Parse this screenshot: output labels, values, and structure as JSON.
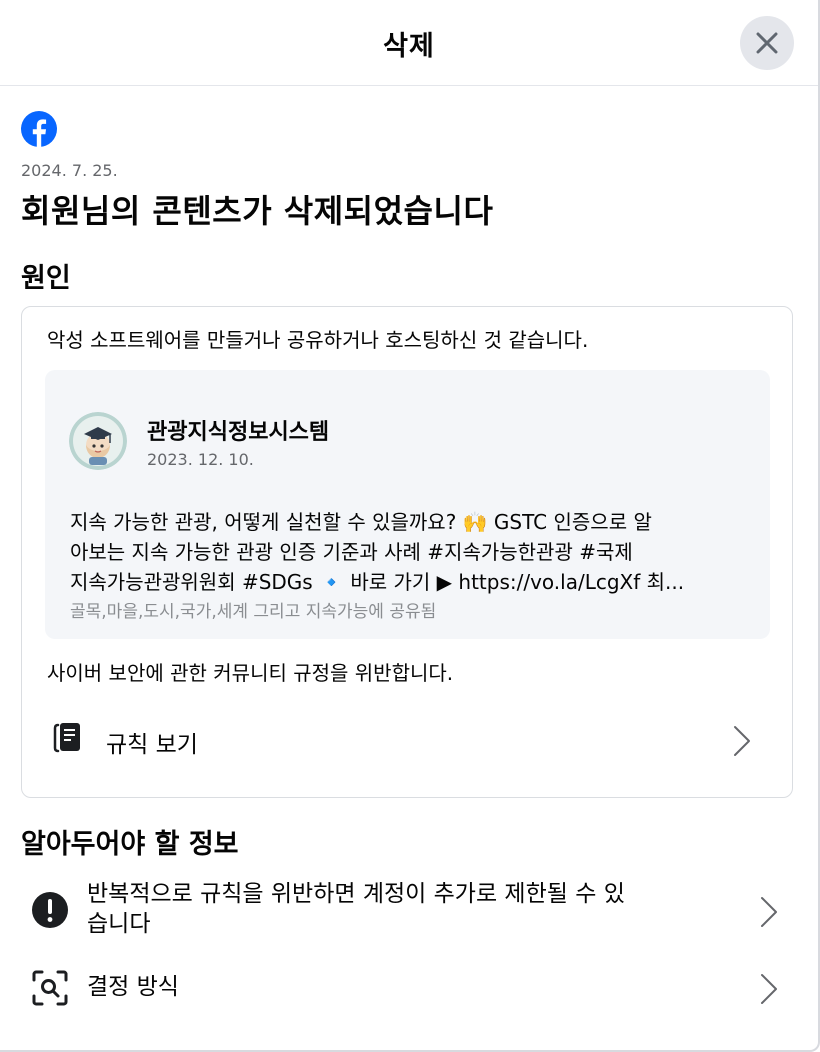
{
  "header": {
    "title": "삭제"
  },
  "notice": {
    "date": "2024. 7. 25.",
    "headline": "회원님의 콘텐츠가 삭제되었습니다"
  },
  "reason": {
    "section_title": "원인",
    "text": "악성 소프트웨어를 만들거나 공유하거나 호스팅하신 것 같습니다.",
    "post": {
      "author": "관광지식정보시스템",
      "date": "2023. 12. 10.",
      "text_lines": [
        "지속 가능한 관광, 어떻게 실천할 수 있을까요? 🙌 GSTC 인증으로 알",
        "아보는 지속 가능한 관광 인증 기준과 사례 #지속가능한관광 #국제",
        "지속가능관광위원회 #SDGs 🔹 바로 가기 ▶ https://vo.la/LcgXf 최..."
      ],
      "caption": "골목,마을,도시,국가,세계 그리고 지속가능에 공유됨"
    },
    "violation": "사이버 보안에 관한 커뮤니티 규정을 위반합니다.",
    "rules_link": "규칙 보기"
  },
  "info": {
    "section_title": "알아두어야 할 정보",
    "items": [
      {
        "icon": "exclamation-icon",
        "label_line1": "반복적으로 규칙을 위반하면 계정이 추가로 제한될 수 있",
        "label_line2": "습니다"
      },
      {
        "icon": "magnifier-icon",
        "label_line1": "결정 방식"
      }
    ]
  },
  "colors": {
    "brand": "#0866ff",
    "secondary_text": "#65676b",
    "card_bg": "#f4f6f9",
    "close_bg": "#e4e6eb"
  }
}
